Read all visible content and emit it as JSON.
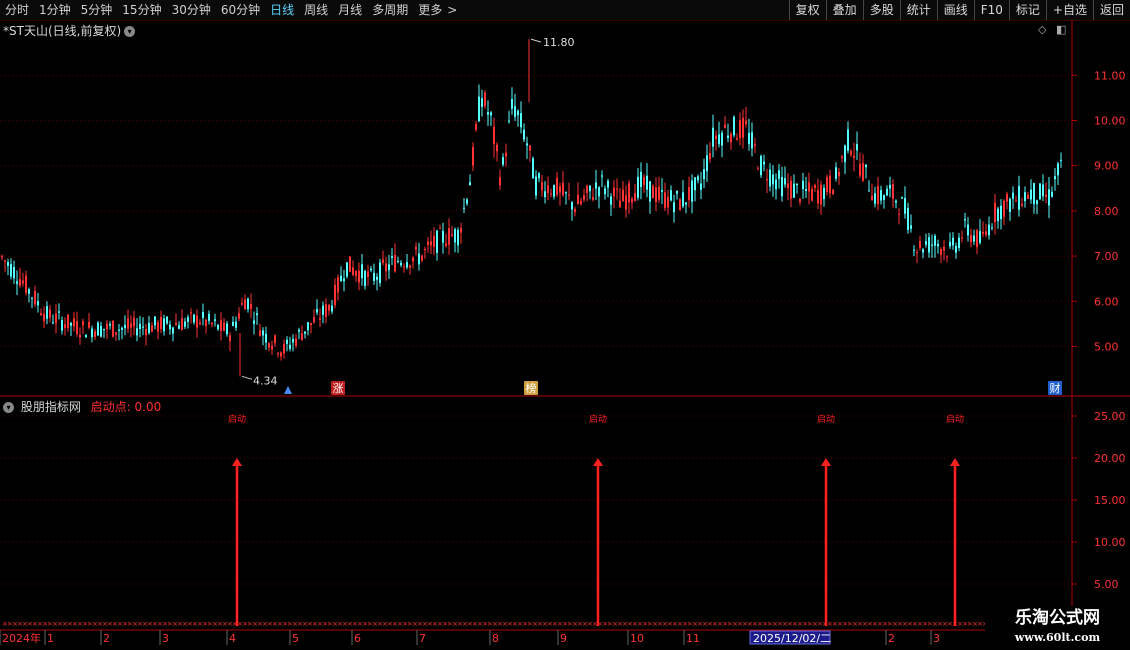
{
  "toolbar": {
    "periods": [
      "分时",
      "1分钟",
      "5分钟",
      "15分钟",
      "30分钟",
      "60分钟",
      "日线",
      "周线",
      "月线",
      "多周期",
      "更多"
    ],
    "active_index": 6,
    "right_buttons": [
      "复权",
      "叠加",
      "多股",
      "统计",
      "画线",
      "F10",
      "标记",
      "+自选",
      "返回"
    ]
  },
  "price_panel": {
    "title": "*ST天山(日线,前复权)",
    "y_ticks": [
      "11.00",
      "10.00",
      "9.00",
      "8.00",
      "7.00",
      "6.00",
      "5.00"
    ],
    "high_label": "11.80",
    "low_label": "4.34",
    "markers": [
      {
        "text": "涨",
        "color": "#c02020"
      },
      {
        "text": "榜",
        "color": "#d0a040"
      },
      {
        "text": "财",
        "color": "#2060d0"
      }
    ],
    "colors": {
      "up": "#ff3333",
      "down": "#54ffff"
    }
  },
  "indicator_panel": {
    "name": "股朋指标网",
    "value_label": "启动点: 0.00",
    "y_ticks": [
      "25.00",
      "20.00",
      "15.00",
      "10.00",
      "5.00"
    ],
    "signal_label": "启动",
    "signal_value": 20,
    "signal_color": "#ff2020"
  },
  "date_axis": {
    "labels": [
      "2024年",
      "1",
      "2",
      "3",
      "4",
      "5",
      "6",
      "7",
      "8",
      "9",
      "10",
      "11",
      "2",
      "3"
    ],
    "cursor_date": "2025/12/02/二"
  },
  "watermark": {
    "line1": "乐淘公式网",
    "line2": "www.60lt.com"
  }
}
